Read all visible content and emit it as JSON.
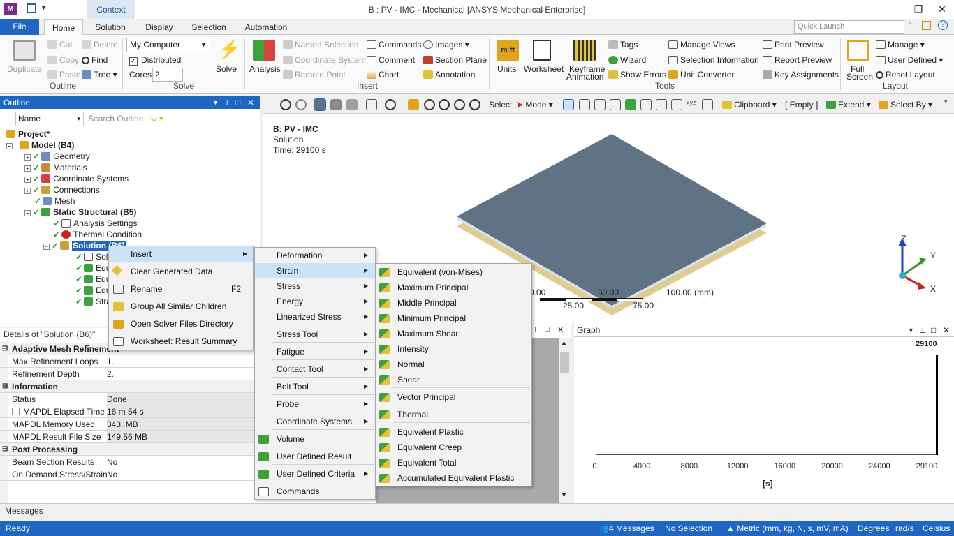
{
  "window": {
    "title": "B : PV - IMC - Mechanical [ANSYS Mechanical Enterprise]",
    "context_tab": "Context",
    "app_icon_letter": "M"
  },
  "tabs": [
    "File",
    "Home",
    "Solution",
    "Display",
    "Selection",
    "Automation"
  ],
  "quick_launch": {
    "placeholder": "Quick Launch"
  },
  "ribbon": {
    "outline": {
      "duplicate": "Duplicate",
      "cut": "Cut",
      "copy": "Copy",
      "paste": "Paste",
      "delete": "Delete",
      "find": "Find",
      "tree": "Tree",
      "group": "Outline"
    },
    "solve": {
      "computer": "My Computer",
      "distributed": "Distributed",
      "cores_label": "Cores",
      "cores_value": "2",
      "solve": "Solve",
      "group": "Solve"
    },
    "insert": {
      "analysis": "Analysis",
      "named_selection": "Named Selection",
      "coordinate_system": "Coordinate System",
      "remote_point": "Remote Point",
      "commands": "Commands",
      "comment": "Comment",
      "chart": "Chart",
      "images": "Images",
      "section_plane": "Section Plane",
      "annotation": "Annotation",
      "group": "Insert"
    },
    "tools": {
      "units": "Units",
      "worksheet": "Worksheet",
      "keyframe": "Keyframe",
      "animation": "Animation",
      "tags": "Tags",
      "wizard": "Wizard",
      "show_errors": "Show Errors",
      "manage_views": "Manage Views",
      "selection_information": "Selection Information",
      "unit_converter": "Unit Converter",
      "print_preview": "Print Preview",
      "report_preview": "Report Preview",
      "key_assignments": "Key Assignments",
      "group": "Tools"
    },
    "layout": {
      "full": "Full",
      "screen": "Screen",
      "manage": "Manage",
      "user_defined": "User Defined",
      "reset_layout": "Reset Layout",
      "group": "Layout"
    }
  },
  "graphics_toolbar": {
    "select": "Select",
    "mode": "Mode",
    "clipboard": "Clipboard",
    "empty": "[ Empty ]",
    "extend": "Extend",
    "select_by": "Select By"
  },
  "outline": {
    "title": "Outline",
    "name_column": "Name",
    "search_placeholder": "Search Outline",
    "items": [
      {
        "label": "Project*"
      },
      {
        "label": "Model (B4)"
      },
      {
        "label": "Geometry"
      },
      {
        "label": "Materials"
      },
      {
        "label": "Coordinate Systems"
      },
      {
        "label": "Connections"
      },
      {
        "label": "Mesh"
      },
      {
        "label": "Static Structural (B5)"
      },
      {
        "label": "Analysis Settings"
      },
      {
        "label": "Thermal Condition"
      },
      {
        "label": "Solution (B6)"
      },
      {
        "label": "Solu"
      },
      {
        "label": "Equi"
      },
      {
        "label": "Equi"
      },
      {
        "label": "Equi"
      },
      {
        "label": "Stra"
      }
    ]
  },
  "viewport": {
    "title": "B: PV - IMC",
    "subtitle": "Solution",
    "time": "Time: 29100 s",
    "axis_z": "Z",
    "axis_y": "Y",
    "axis_x": "X",
    "scale": {
      "t0": "0.00",
      "t50": "50.00",
      "t100": "100.00 (mm)",
      "t25": "25.00",
      "t75": "75.00"
    }
  },
  "details": {
    "title": "Details of \"Solution (B6)\"",
    "sections": [
      {
        "name": "Adaptive Mesh Refinement",
        "rows": [
          {
            "k": "Max Refinement Loops",
            "v": "1."
          },
          {
            "k": "Refinement Depth",
            "v": "2."
          }
        ]
      },
      {
        "name": "Information",
        "rows": [
          {
            "k": "Status",
            "v": "Done"
          },
          {
            "k": "MAPDL Elapsed Time",
            "v": "16 m 54 s"
          },
          {
            "k": "MAPDL Memory Used",
            "v": "343. MB"
          },
          {
            "k": "MAPDL Result File Size",
            "v": "149.56 MB"
          }
        ]
      },
      {
        "name": "Post Processing",
        "rows": [
          {
            "k": "Beam Section Results",
            "v": "No"
          },
          {
            "k": "On Demand Stress/Strain",
            "v": "No"
          }
        ]
      }
    ]
  },
  "graph": {
    "title": "Graph",
    "top_value": "29100",
    "xlabel": "[s]",
    "ticks": [
      "0.",
      "4000.",
      "8000.",
      "12000",
      "16000",
      "20000",
      "24000",
      "29100"
    ]
  },
  "context_menu": {
    "items": [
      {
        "label": "Insert"
      },
      {
        "label": "Clear Generated Data"
      },
      {
        "label": "Rename",
        "shortcut": "F2"
      },
      {
        "label": "Group All Similar Children"
      },
      {
        "label": "Open Solver Files Directory"
      },
      {
        "label": "Worksheet: Result Summary"
      }
    ]
  },
  "insert_menu": {
    "items": [
      "Deformation",
      "Strain",
      "Stress",
      "Energy",
      "Linearized Stress",
      "Stress Tool",
      "Fatigue",
      "Contact Tool",
      "Bolt Tool",
      "Probe",
      "Coordinate Systems",
      "Volume",
      "User Defined Result",
      "User Defined Criteria",
      "Commands"
    ]
  },
  "strain_menu": {
    "items": [
      "Equivalent (von-Mises)",
      "Maximum Principal",
      "Middle Principal",
      "Minimum Principal",
      "Maximum Shear",
      "Intensity",
      "Normal",
      "Shear",
      "Vector Principal",
      "Thermal",
      "Equivalent Plastic",
      "Equivalent Creep",
      "Equivalent Total",
      "Accumulated Equivalent Plastic"
    ]
  },
  "messages": {
    "label": "Messages"
  },
  "status": {
    "ready": "Ready",
    "messages": "4 Messages",
    "selection": "No Selection",
    "units": "Metric (mm, kg, N, s, mV, mA)",
    "degrees": "Degrees",
    "rads": "rad/s",
    "celsius": "Celsius"
  },
  "colors": {
    "accent": "#1f66c2",
    "highlight": "#cce3f7",
    "plate": "#5f7384"
  }
}
